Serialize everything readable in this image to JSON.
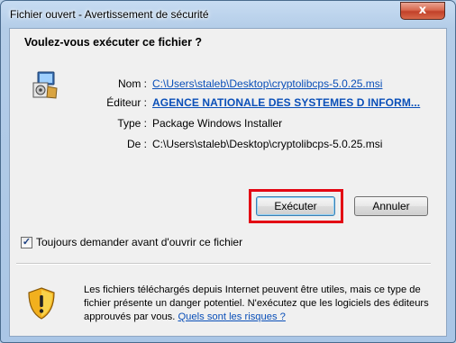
{
  "window": {
    "title": "Fichier ouvert - Avertissement de sécurité",
    "close_label": "x"
  },
  "dialog": {
    "question": "Voulez-vous exécuter ce fichier ?",
    "file_icon": "package-icon",
    "fields": {
      "name_label": "Nom :",
      "name_value": "C:\\Users\\staleb\\Desktop\\cryptolibcps-5.0.25.msi",
      "publisher_label": "Éditeur :",
      "publisher_value": "AGENCE NATIONALE DES SYSTEMES D INFORM...",
      "type_label": "Type :",
      "type_value": "Package Windows Installer",
      "from_label": "De :",
      "from_value": "C:\\Users\\staleb\\Desktop\\cryptolibcps-5.0.25.msi"
    },
    "buttons": {
      "run_label": "Exécuter",
      "cancel_label": "Annuler"
    },
    "checkbox": {
      "label": "Toujours demander avant d'ouvrir ce fichier",
      "checked": true,
      "mark": "✓"
    },
    "warning": {
      "icon": "shield-icon",
      "text": "Les fichiers téléchargés depuis Internet peuvent être utiles, mais ce type de fichier présente un danger potentiel. N'exécutez que les logiciels des éditeurs approuvés par vous. ",
      "link": "Quels sont les risques ?"
    }
  },
  "colors": {
    "link": "#0a4fb8",
    "highlight": "#e30613",
    "close": "#c2412a"
  }
}
